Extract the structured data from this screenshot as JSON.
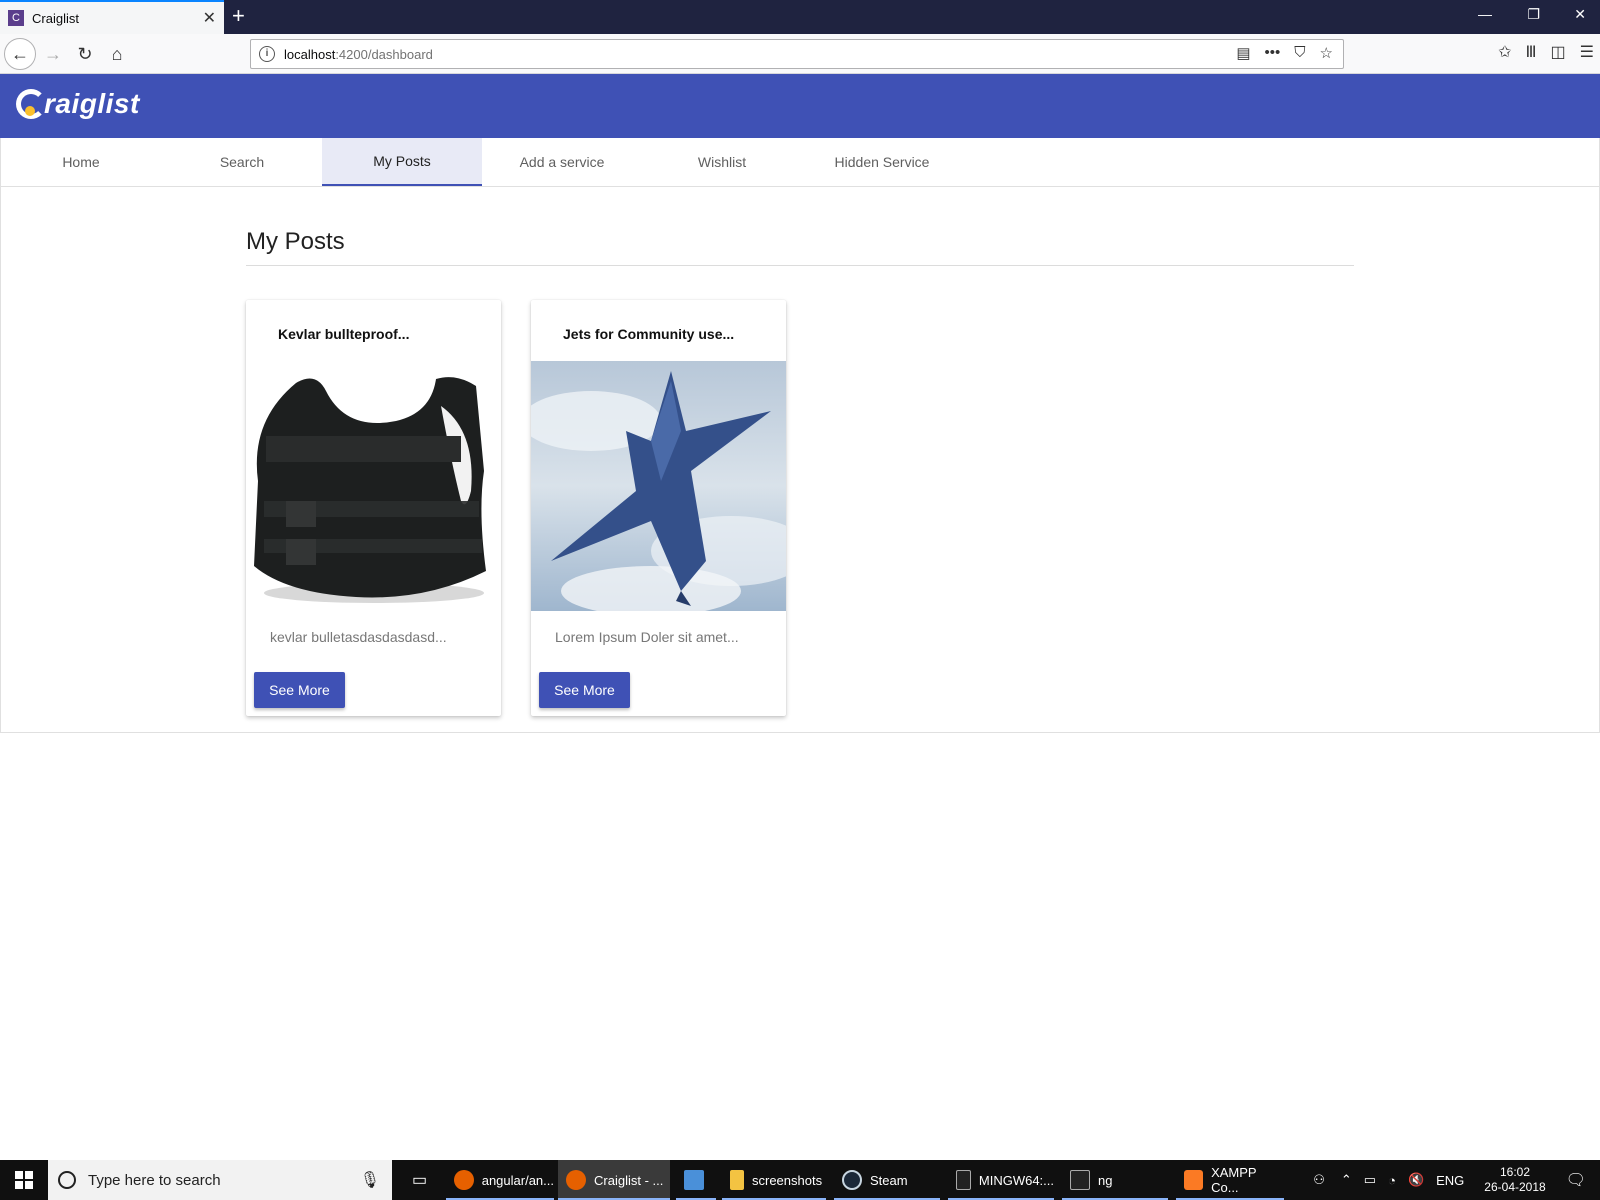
{
  "browser": {
    "tab_title": "Craiglist",
    "tab_favicon": "C",
    "url_host": "localhost",
    "url_rest": ":4200/dashboard"
  },
  "app": {
    "logo_text": "raiglist",
    "tabs": [
      {
        "label": "Home"
      },
      {
        "label": "Search"
      },
      {
        "label": "My Posts"
      },
      {
        "label": "Add a service"
      },
      {
        "label": "Wishlist"
      },
      {
        "label": "Hidden Service"
      }
    ],
    "active_tab": "My Posts",
    "page_title": "My Posts",
    "accent_color": "#3f51b5"
  },
  "posts": [
    {
      "title": "Kevlar bullteproof...",
      "description": "kevlar bulletasdasdasdasd...",
      "image": "bulletproof-vest-image",
      "button": "See More"
    },
    {
      "title": "Jets for Community use...",
      "description": "Lorem Ipsum Doler sit amet...",
      "image": "fighter-jet-image",
      "button": "See More"
    }
  ],
  "taskbar": {
    "search_placeholder": "Type here to search",
    "items": [
      {
        "label": "angular/an..."
      },
      {
        "label": "Craiglist - ..."
      },
      {
        "label": ""
      },
      {
        "label": "screenshots"
      },
      {
        "label": "Steam"
      },
      {
        "label": "MINGW64:..."
      },
      {
        "label": "ng"
      },
      {
        "label": "XAMPP Co..."
      }
    ],
    "language": "ENG",
    "time": "16:02",
    "date": "26-04-2018"
  }
}
